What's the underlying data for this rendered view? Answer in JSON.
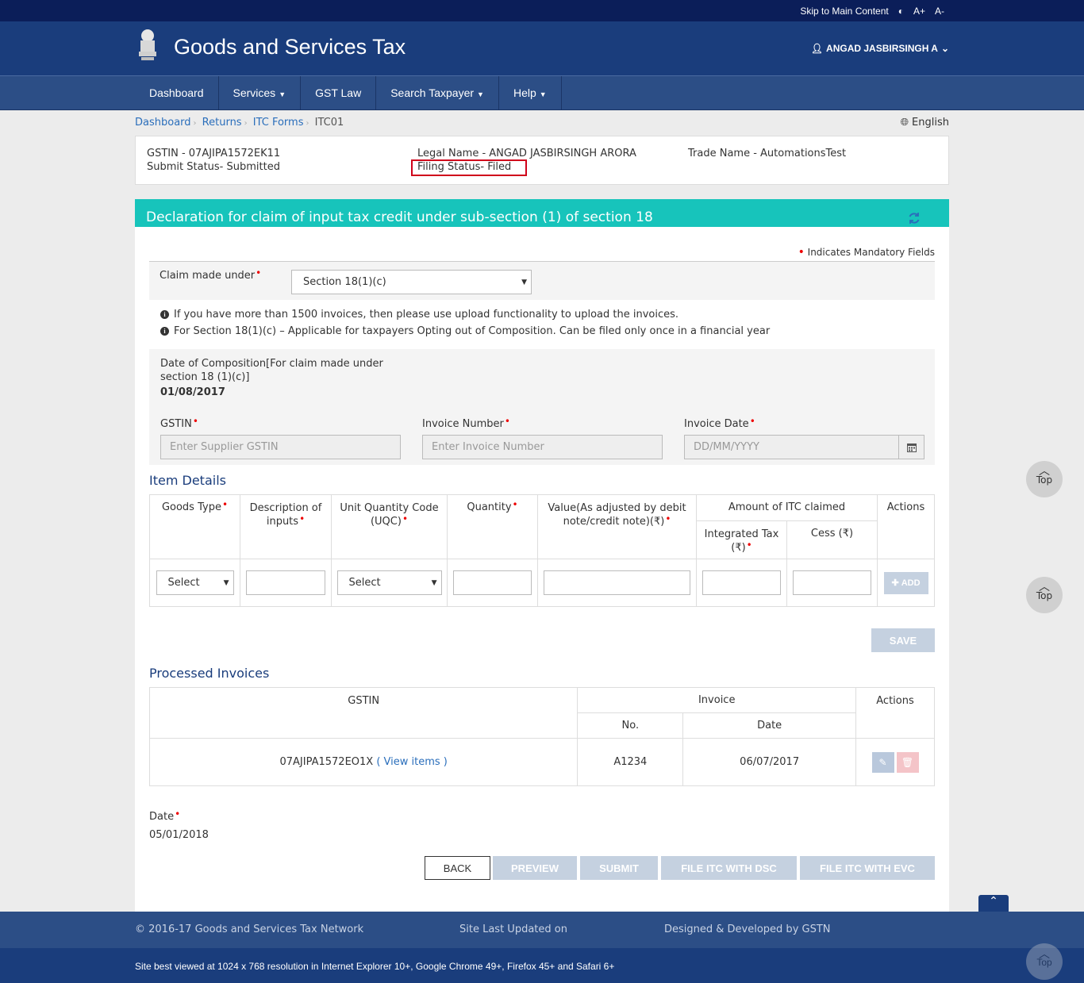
{
  "topbar": {
    "skip_label": "Skip to Main Content",
    "font_up": "A+",
    "font_down": "A-"
  },
  "header": {
    "title": "Goods and Services Tax",
    "user": "ANGAD JASBIRSINGH A"
  },
  "nav": {
    "items": [
      "Dashboard",
      "Services",
      "GST Law",
      "Search Taxpayer",
      "Help"
    ]
  },
  "breadcrumb": {
    "items": [
      "Dashboard",
      "Returns",
      "ITC Forms"
    ],
    "current": "ITC01"
  },
  "language": "English",
  "info": {
    "gstin": "GSTIN - 07AJIPA1572EK11",
    "submit_status": "Submit Status- Submitted",
    "legal_name": "Legal Name - ANGAD JASBIRSINGH ARORA",
    "filing_status": "Filing Status- Filed",
    "trade_name": "Trade Name - AutomationsTest"
  },
  "form": {
    "heading": "Declaration for claim of input tax credit under sub-section (1) of section 18",
    "mandatory_note": "Indicates Mandatory Fields",
    "claim_label": "Claim made under",
    "claim_value": "Section 18(1)(c)",
    "note1": "If you have more than 1500 invoices, then please use upload functionality to upload the invoices.",
    "note2": "For Section 18(1)(c) – Applicable for taxpayers Opting out of Composition. Can be filed only once in a financial year",
    "composition_label_1": "Date of Composition[For claim made under",
    "composition_label_2": "section 18 (1)(c)]",
    "composition_date": "01/08/2017",
    "gstin_label": "GSTIN",
    "gstin_placeholder": "Enter Supplier GSTIN",
    "invoice_no_label": "Invoice Number",
    "invoice_no_placeholder": "Enter Invoice Number",
    "invoice_date_label": "Invoice Date",
    "invoice_date_placeholder": "DD/MM/YYYY"
  },
  "item_details": {
    "title": "Item Details",
    "headers": {
      "goods_type": "Goods Type",
      "description_1": "Description of",
      "description_2": "inputs",
      "uqc_1": "Unit Quantity Code",
      "uqc_2": "(UQC)",
      "quantity": "Quantity",
      "value_1": "Value(As adjusted by debit",
      "value_2": "note/credit note)(₹)",
      "itc_group": "Amount of ITC claimed",
      "integrated_1": "Integrated Tax",
      "integrated_2": "(₹)",
      "cess": "Cess (₹)",
      "actions": "Actions"
    },
    "goods_select": "Select",
    "uqc_select": "Select",
    "add_button": "ADD",
    "save_button": "SAVE"
  },
  "processed": {
    "title": "Processed Invoices",
    "headers": {
      "gstin": "GSTIN",
      "invoice": "Invoice",
      "no": "No.",
      "date": "Date",
      "actions": "Actions"
    },
    "rows": [
      {
        "gstin": "07AJIPA1572EO1X",
        "view": "( View items )",
        "no": "A1234",
        "date": "06/07/2017"
      }
    ]
  },
  "date_section": {
    "label": "Date",
    "value": "05/01/2018"
  },
  "buttons": {
    "back": "BACK",
    "preview": "PREVIEW",
    "submit": "SUBMIT",
    "file_dsc": "FILE ITC WITH DSC",
    "file_evc": "FILE ITC WITH EVC"
  },
  "totop_label": "Top",
  "footer": {
    "copyright": "© 2016-17 Goods and Services Tax Network",
    "updated": "Site Last Updated on",
    "designed": "Designed & Developed by GSTN",
    "best_viewed": "Site best viewed at 1024 x 768 resolution in Internet Explorer 10+, Google Chrome 49+, Firefox 45+ and Safari 6+"
  },
  "colors": {
    "header": "#1a3d7c",
    "nav": "#2c4e86",
    "teal": "#17c4bb",
    "disabled_btn": "#c5d1e0",
    "highlight": "#d0021b"
  }
}
